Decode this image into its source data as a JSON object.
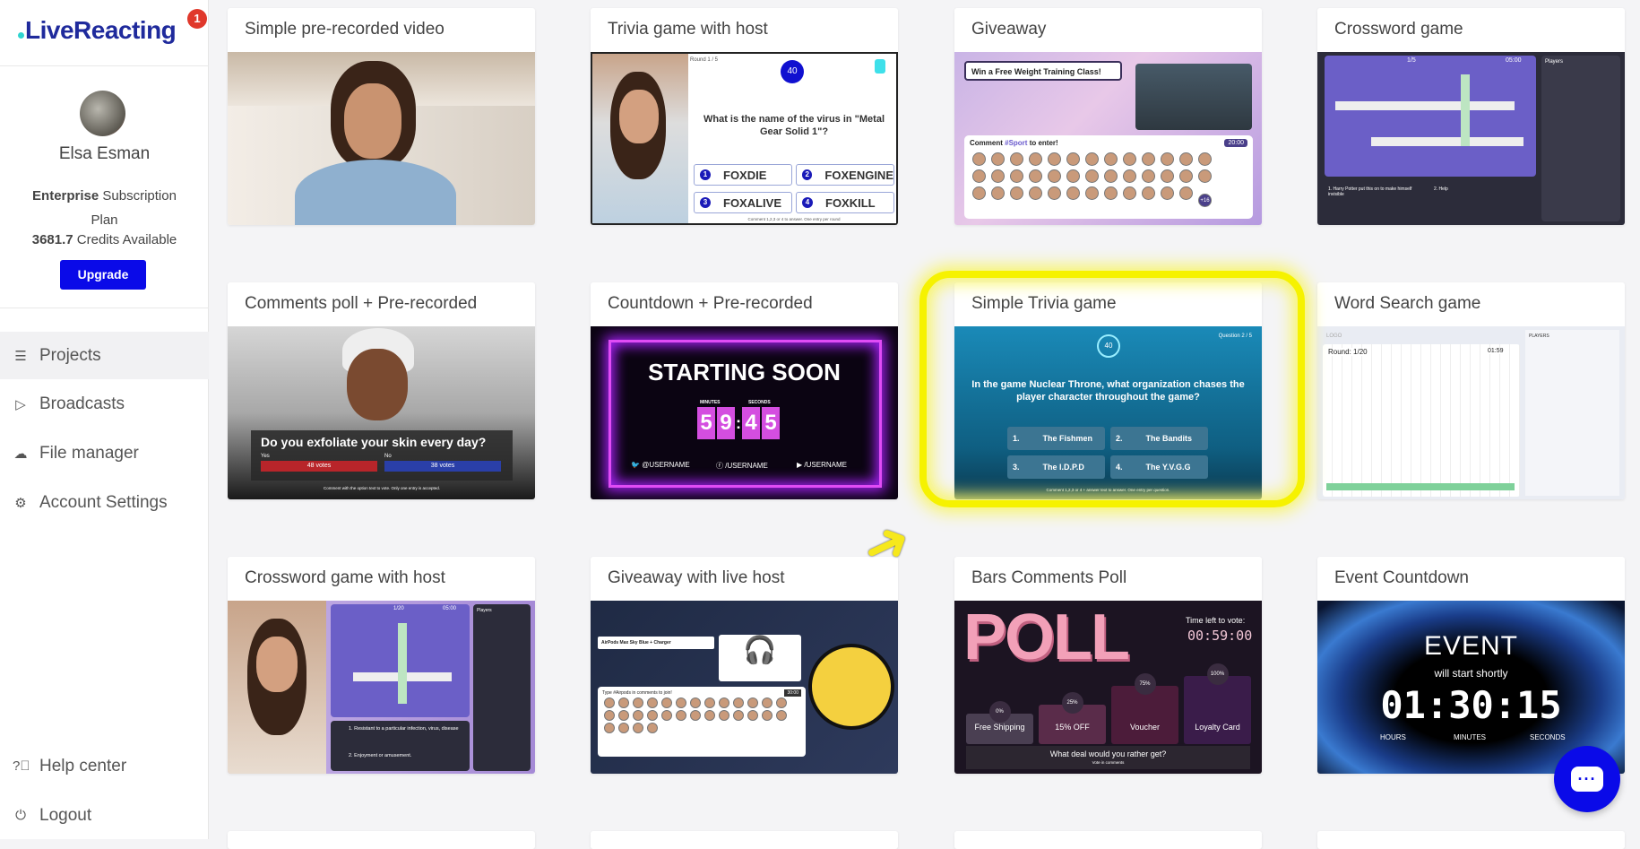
{
  "sidebar": {
    "logo": "LiveReacting",
    "notification_count": "1",
    "user_name": "Elsa Esman",
    "plan_bold": "Enterprise",
    "plan_rest": " Subscription Plan",
    "credits_value": "3681.7",
    "credits_label": " Credits Available",
    "upgrade": "Upgrade",
    "nav": [
      {
        "label": "Projects",
        "icon": "menu-icon"
      },
      {
        "label": "Broadcasts",
        "icon": "play-icon"
      },
      {
        "label": "File manager",
        "icon": "cloud-upload-icon"
      },
      {
        "label": "Account Settings",
        "icon": "gear-icon"
      }
    ],
    "footer": [
      {
        "label": "Help center",
        "icon": "help-icon"
      },
      {
        "label": "Logout",
        "icon": "logout-icon"
      }
    ]
  },
  "cards": [
    {
      "title": "Simple pre-recorded video"
    },
    {
      "title": "Trivia game with host",
      "round": "Round 1 / 5",
      "timer": "40",
      "question": "What is the name of the virus in \"Metal Gear Solid 1\"?",
      "options": [
        "FOXDIE",
        "FOXENGINE",
        "FOXALIVE",
        "FOXKILL"
      ],
      "footer": "Comment 1,2,3 or 4 to answer. One entry per round"
    },
    {
      "title": "Giveaway",
      "headline": "Win a Free Weight Training Class!",
      "prompt_pre": "Comment ",
      "prompt_tag": "#Sport",
      "prompt_post": " to enter!",
      "timer": "20:00",
      "more": "+16"
    },
    {
      "title": "Crossword game",
      "progress": "1/5",
      "timer": "05:00",
      "players": "Players",
      "clue1": "1. Harry Potter put this on to make himself invisible",
      "clue2": "2. Help"
    },
    {
      "title": "Comments poll + Pre-recorded",
      "question": "Do you exfoliate your skin every day?",
      "yes": "Yes",
      "no": "No",
      "yes_votes": "48 votes",
      "no_votes": "38 votes",
      "footer": "Comment with the option text to vote. Only one entry is accepted."
    },
    {
      "title": "Countdown + Pre-recorded",
      "headline": "STARTING SOON",
      "minutes": "MINUTES",
      "seconds": "SECONDS",
      "digits": [
        "5",
        "9",
        "4",
        "5"
      ],
      "twitter": "@USERNAME",
      "facebook": "/USERNAME",
      "youtube": "/USERNAME"
    },
    {
      "title": "Simple Trivia game",
      "timer": "40",
      "question_no": "Question 2 / 5",
      "question": "In the game Nuclear Throne, what organization chases the player character throughout the game?",
      "options": [
        {
          "n": "1.",
          "t": "The Fishmen"
        },
        {
          "n": "2.",
          "t": "The Bandits"
        },
        {
          "n": "3.",
          "t": "The I.D.P.D"
        },
        {
          "n": "4.",
          "t": "The Y.V.G.G"
        }
      ],
      "footer": "Comment 1,2,3 or 4 + answer text to answer. One entry per question."
    },
    {
      "title": "Word Search game",
      "logo": "LOGO",
      "round": "Round: 1/20",
      "timer": "01:59",
      "players": "PLAYERS"
    },
    {
      "title": "Crossword game with host",
      "progress": "1/20",
      "timer": "05:00",
      "players": "Players",
      "clue1": "1. Resistant to a particular infection, virus, disease",
      "clue2": "2. Enjoyment or amusement."
    },
    {
      "title": "Giveaway with live host",
      "prize": "AirPods Max Sky Blue + Charger",
      "prompt": "Type #Airpods in comments to join!",
      "timer": "30:00"
    },
    {
      "title": "Bars Comments Poll",
      "poll": "POLL",
      "time_label": "Time left to vote:",
      "time": "00:59:00",
      "bars": [
        {
          "label": "Free Shipping",
          "pct": "0%",
          "value": 0
        },
        {
          "label": "15% OFF",
          "pct": "25%",
          "value": 25
        },
        {
          "label": "Voucher",
          "pct": "75%",
          "value": 75
        },
        {
          "label": "Loyalty Card",
          "pct": "100%",
          "value": 100
        }
      ],
      "question": "What deal would you rather get?",
      "footer": "Vote in comments"
    },
    {
      "title": "Event Countdown",
      "headline": "EVENT",
      "sub": "will start shortly",
      "time": "01:30:15",
      "units": [
        "HOURS",
        "MINUTES",
        "SECONDS"
      ]
    }
  ],
  "chat_icon": "chat-bubble-icon",
  "colors": {
    "brand": "#0a0ae8",
    "highlight": "#f6f200"
  }
}
